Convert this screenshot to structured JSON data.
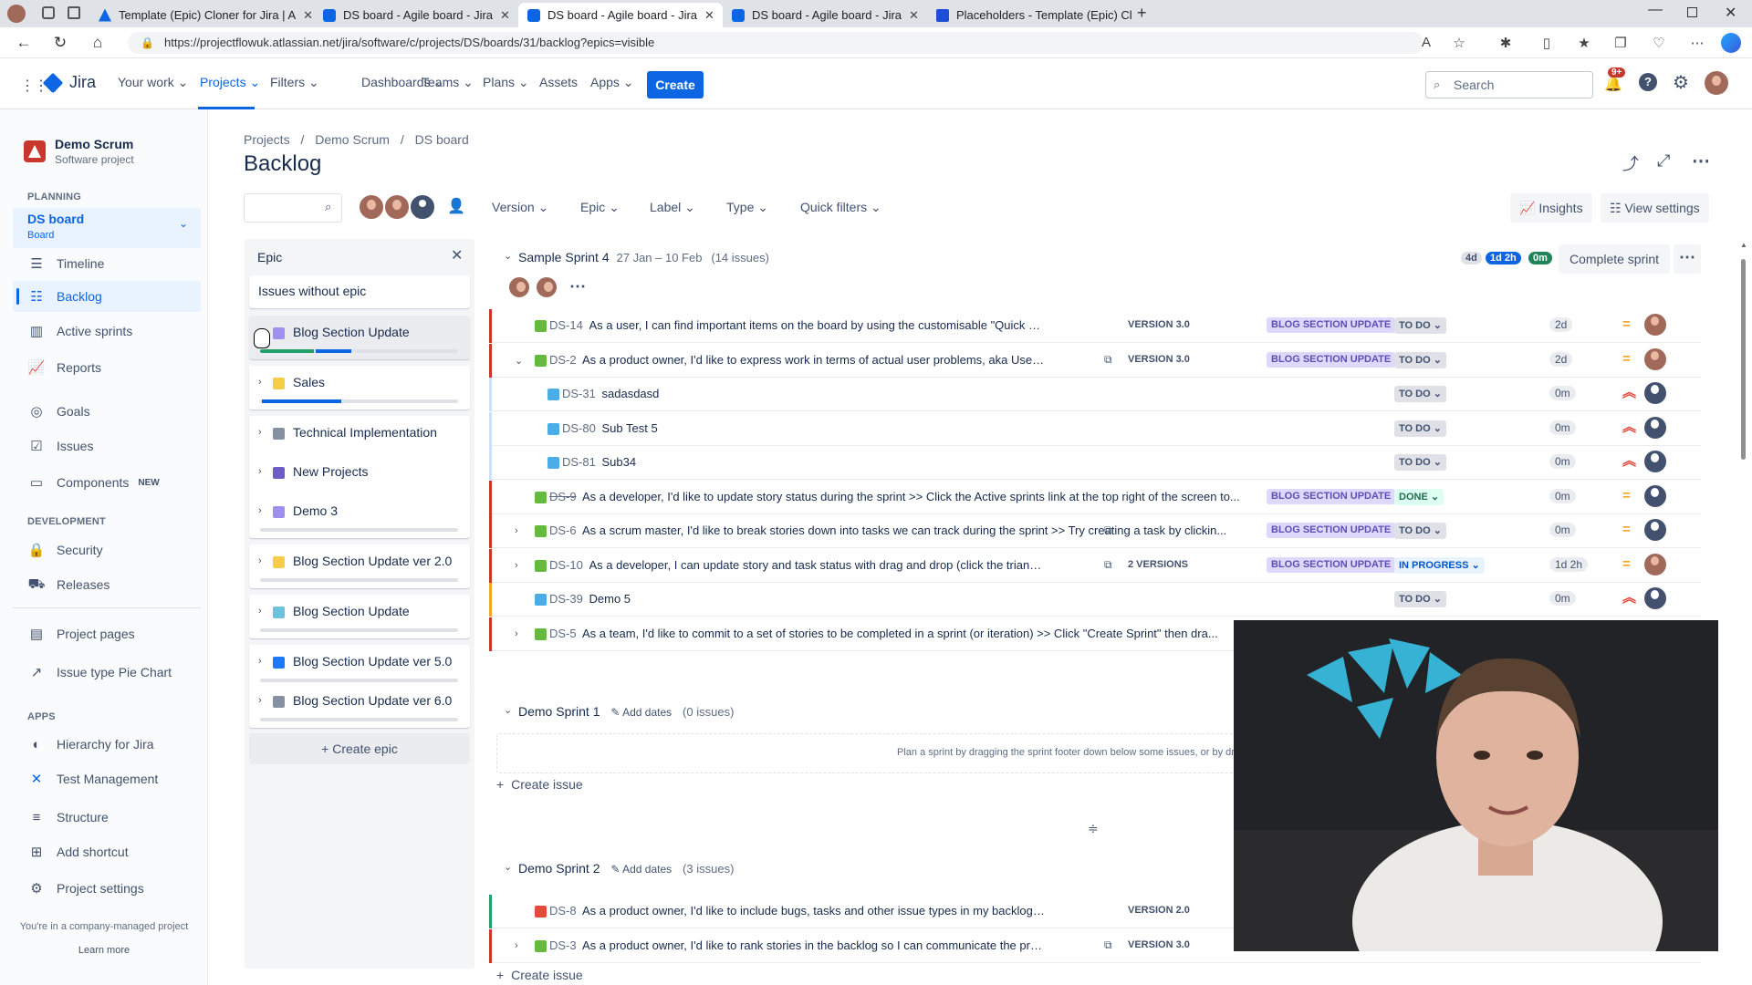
{
  "browser": {
    "tabs": [
      {
        "title": "Template (Epic) Cloner for Jira | A",
        "active": false
      },
      {
        "title": "DS board - Agile board - Jira",
        "active": false
      },
      {
        "title": "DS board - Agile board - Jira",
        "active": true
      },
      {
        "title": "DS board - Agile board - Jira",
        "active": false
      },
      {
        "title": "Placeholders - Template (Epic) Cl",
        "active": false
      }
    ],
    "url": "https://projectflowuk.atlassian.net/jira/software/c/projects/DS/boards/31/backlog?epics=visible"
  },
  "topnav": {
    "product": "Jira",
    "items": [
      "Your work",
      "Projects",
      "Filters",
      "Dashboards",
      "Teams",
      "Plans",
      "Assets",
      "Apps"
    ],
    "create": "Create",
    "search_placeholder": "Search",
    "notif_badge": "9+"
  },
  "sidebar": {
    "project_name": "Demo Scrum",
    "project_type": "Software project",
    "planning_head": "PLANNING",
    "board_name": "DS board",
    "board_sub": "Board",
    "planning_items": [
      "Timeline",
      "Backlog",
      "Active sprints",
      "Reports"
    ],
    "other_items": [
      "Goals",
      "Issues",
      "Components"
    ],
    "components_badge": "NEW",
    "development_head": "DEVELOPMENT",
    "development_items": [
      "Security",
      "Releases"
    ],
    "misc_items": [
      "Project pages",
      "Issue type Pie Chart"
    ],
    "apps_head": "APPS",
    "apps_items": [
      "Hierarchy for Jira",
      "Test Management",
      "Structure",
      "Add shortcut",
      "Project settings"
    ],
    "footer_text": "You're in a company-managed project",
    "footer_link": "Learn more"
  },
  "breadcrumb": [
    "Projects",
    "Demo Scrum",
    "DS board"
  ],
  "page_title": "Backlog",
  "filters": [
    "Version",
    "Epic",
    "Label",
    "Type",
    "Quick filters"
  ],
  "toolbar": {
    "insights": "Insights",
    "view_settings": "View settings"
  },
  "epic_panel": {
    "title": "Epic",
    "issues_without_epic": "Issues without epic",
    "epics": [
      {
        "name": "Blog Section Update",
        "color": "#9f8fef",
        "progress_done": 0.27,
        "progress_inprog": 0.18
      },
      {
        "name": "Sales",
        "color": "#f5cd47",
        "progress_done": 0,
        "progress_inprog": 0.4
      },
      {
        "name": "Technical Implementation",
        "color": "#8590a2",
        "progress_done": 0,
        "progress_inprog": 0
      },
      {
        "name": "New Projects",
        "color": "#6e5dc6",
        "progress_done": 0,
        "progress_inprog": 0
      },
      {
        "name": "Demo 3",
        "color": "#9f8fef",
        "progress_done": 0,
        "progress_inprog": 0
      },
      {
        "name": "Blog Section Update ver 2.0",
        "color": "#f5cd47",
        "progress_done": 0,
        "progress_inprog": 0
      },
      {
        "name": "Blog Section Update",
        "color": "#6cc3e0",
        "progress_done": 0,
        "progress_inprog": 0
      },
      {
        "name": "Blog Section Update ver 5.0",
        "color": "#1d7afc",
        "progress_done": 0,
        "progress_inprog": 0
      },
      {
        "name": "Blog Section Update ver 6.0",
        "color": "#8590a2",
        "progress_done": 0,
        "progress_inprog": 0
      }
    ],
    "create_epic": "+ Create epic"
  },
  "sprint4": {
    "name": "Sample Sprint 4",
    "dates": "27 Jan – 10 Feb",
    "count": "(14 issues)",
    "est_todo": "4d",
    "est_inprog": "1d 2h",
    "est_done": "0m",
    "complete": "Complete sprint",
    "issues": [
      {
        "key": "DS-14",
        "summary": "As a user, I can find important items on the board by using the customisable \"Quick Filters\" above ...",
        "version": "VERSION 3.0",
        "epic": "BLOG SECTION UPDATE",
        "status": "TO DO",
        "est": "2d",
        "bar": "#c9372c",
        "type": "story"
      },
      {
        "key": "DS-2",
        "summary": "As a product owner, I'd like to express work in terms of actual user problems, aka User Stories, a...",
        "version": "VERSION 3.0",
        "epic": "BLOG SECTION UPDATE",
        "status": "TO DO",
        "est": "2d",
        "bar": "#c9372c",
        "type": "story"
      },
      {
        "key": "DS-31",
        "summary": "sadasdasd",
        "version": "",
        "epic": "",
        "status": "TO DO",
        "est": "0m",
        "bar": "#cce0ff",
        "type": "subtask"
      },
      {
        "key": "DS-80",
        "summary": "Sub Test 5",
        "version": "",
        "epic": "",
        "status": "TO DO",
        "est": "0m",
        "bar": "#cce0ff",
        "type": "subtask"
      },
      {
        "key": "DS-81",
        "summary": "Sub34",
        "version": "",
        "epic": "",
        "status": "TO DO",
        "est": "0m",
        "bar": "#cce0ff",
        "type": "subtask"
      },
      {
        "key": "DS-9",
        "summary": "As a developer, I'd like to update story status during the sprint >> Click the Active sprints link at the top right of the screen to...",
        "version": "",
        "epic": "BLOG SECTION UPDATE",
        "status": "DONE",
        "est": "0m",
        "bar": "#c9372c",
        "type": "story"
      },
      {
        "key": "DS-6",
        "summary": "As a scrum master, I'd like to break stories down into tasks we can track during the sprint >> Try creating a task by clickin...",
        "version": "",
        "epic": "BLOG SECTION UPDATE",
        "status": "TO DO",
        "est": "0m",
        "bar": "#c9372c",
        "type": "story"
      },
      {
        "key": "DS-10",
        "summary": "As a developer, I can update story and task status with drag and drop (click the triangle at far l...",
        "version": "2 VERSIONS",
        "epic": "BLOG SECTION UPDATE",
        "status": "IN PROGRESS",
        "est": "1d 2h",
        "bar": "#c9372c",
        "type": "story"
      },
      {
        "key": "DS-39",
        "summary": "Demo 5",
        "version": "",
        "epic": "",
        "status": "TO DO",
        "est": "0m",
        "bar": "#f5a623",
        "type": "task"
      },
      {
        "key": "DS-5",
        "summary": "As a team, I'd like to commit to a set of stories to be completed in a sprint (or iteration) >> Click \"Create Sprint\" then dra...",
        "version": "",
        "epic": "",
        "status": "",
        "est": "",
        "bar": "#c9372c",
        "type": "story"
      }
    ]
  },
  "sprint1": {
    "name": "Demo Sprint 1",
    "add_dates": "Add dates",
    "count": "(0 issues)",
    "empty_hint": "Plan a sprint by dragging the sprint footer down below some issues, or by draggi",
    "create_issue": "Create issue"
  },
  "sprint2": {
    "name": "Demo Sprint 2",
    "add_dates": "Add dates",
    "count": "(3 issues)",
    "issues": [
      {
        "key": "DS-8",
        "summary": "As a product owner, I'd like to include bugs, tasks and other issue types in my backlog >> Bugs like ...",
        "version": "VERSION 2.0",
        "bar": "#22a06b",
        "type": "bug"
      },
      {
        "key": "DS-3",
        "summary": "As a product owner, I'd like to rank stories in the backlog so I can communicate the proposed i...",
        "version": "VERSION 3.0",
        "bar": "#c9372c",
        "type": "story"
      }
    ],
    "create_issue": "Create issue"
  },
  "colors": {
    "brand": "#0c66e4",
    "story": "#63ba3c",
    "subtask": "#4bade8",
    "bug": "#e5493a",
    "task": "#4bade8"
  }
}
